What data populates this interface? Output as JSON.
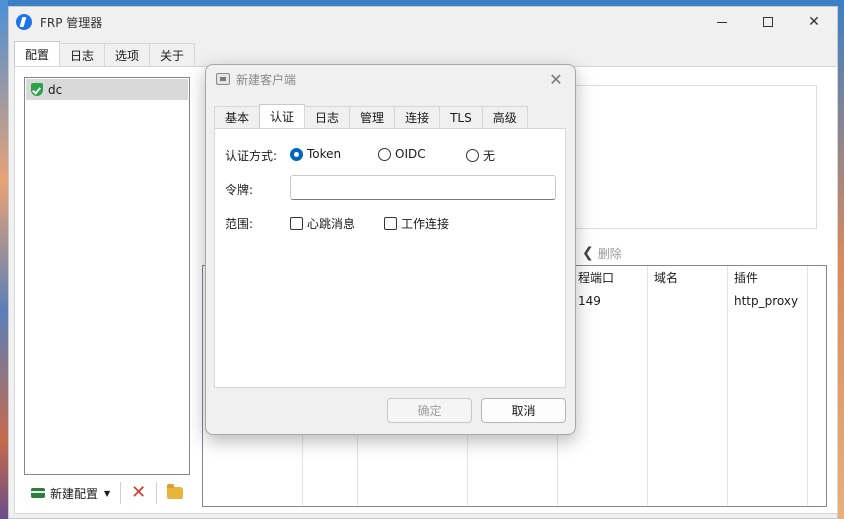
{
  "window": {
    "title": "FRP 管理器"
  },
  "main_tabs": [
    "配置",
    "日志",
    "选项",
    "关于"
  ],
  "config_list": {
    "items": [
      {
        "name": "dc"
      }
    ]
  },
  "list_toolbar": {
    "new_config": "新建配置"
  },
  "proxy_toolbar": {
    "delete": "删除"
  },
  "proxy_table": {
    "headers": [
      "程端口",
      "域名",
      "插件"
    ],
    "rows": [
      [
        "149",
        "",
        "http_proxy"
      ]
    ]
  },
  "dialog": {
    "title": "新建客户端",
    "tabs": [
      "基本",
      "认证",
      "日志",
      "管理",
      "连接",
      "TLS",
      "高级"
    ],
    "auth_method_label": "认证方式:",
    "auth_options": [
      "Token",
      "OIDC",
      "无"
    ],
    "auth_selected": "Token",
    "token_label": "令牌:",
    "token_value": "",
    "scope_label": "范围:",
    "scope_options": [
      "心跳消息",
      "工作连接"
    ],
    "ok": "确定",
    "cancel": "取消"
  }
}
